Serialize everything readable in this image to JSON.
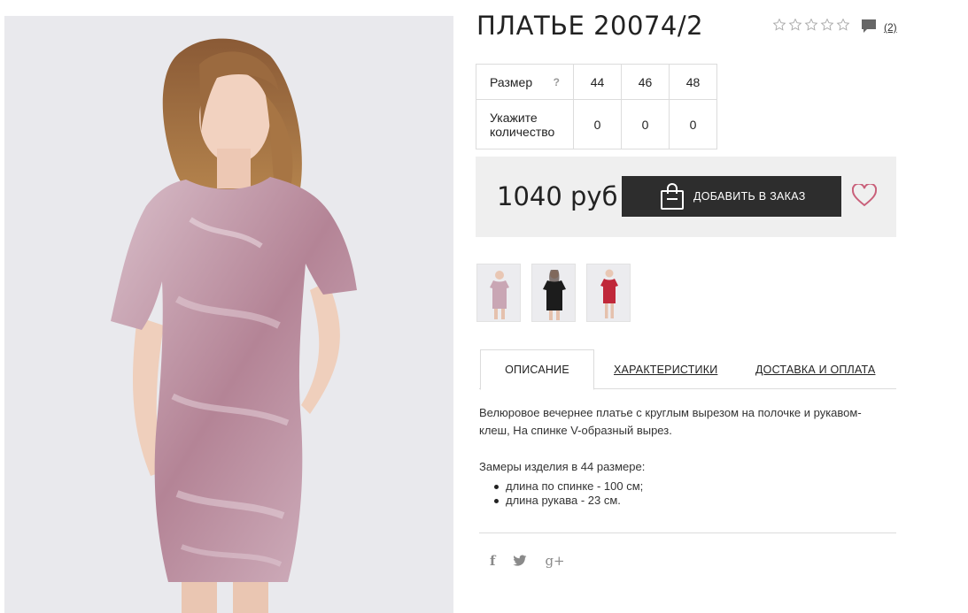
{
  "product": {
    "title": "ПЛАТЬЕ 20074/2",
    "rating_stars": 0,
    "max_stars": 5,
    "review_count": "(2)"
  },
  "sizes": {
    "size_label": "Размер",
    "help": "?",
    "qty_label_line1": "Укажите",
    "qty_label_line2": "количество",
    "values": [
      "44",
      "46",
      "48"
    ],
    "quantities": [
      "0",
      "0",
      "0"
    ]
  },
  "purchase": {
    "price": "1040 руб",
    "add_button": "ДОБАВИТЬ В ЗАКАЗ"
  },
  "tabs": [
    {
      "label": "ОПИСАНИЕ"
    },
    {
      "label": "ХАРАКТЕРИСТИКИ"
    },
    {
      "label": "ДОСТАВКА И ОПЛАТА"
    }
  ],
  "description": {
    "text": "Велюровое вечернее платье с круглым вырезом на полочке и рукавом-клеш, На спинке V-образный вырез.",
    "measures_title": "Замеры изделия в 44 размере:",
    "measures": [
      "длина по спинке - 100 см;",
      "длина рукава - 23 см."
    ]
  },
  "social": {
    "facebook": "f",
    "twitter": "twitter-icon",
    "gplus": "g+"
  },
  "colors": {
    "button_bg": "#2d2d2d",
    "heart": "#c9607a",
    "panel_bg": "#efefef",
    "dress_pink": "#b98a9c",
    "thumb_black": "#1c1c1c",
    "thumb_red": "#c0283a"
  }
}
